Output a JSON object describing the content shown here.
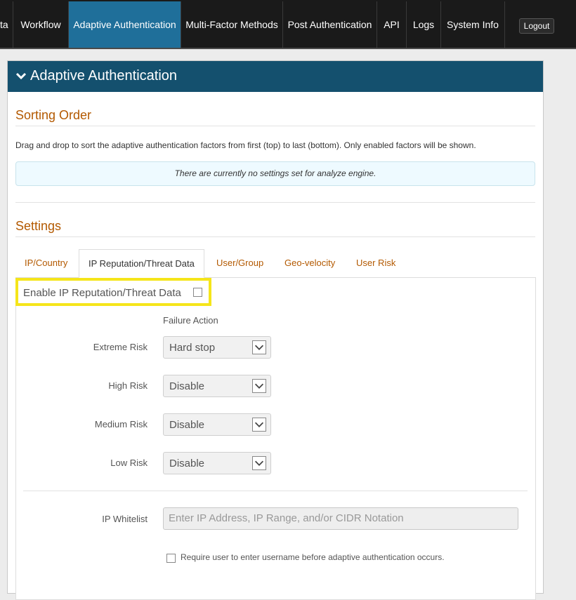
{
  "nav": {
    "items": [
      "ta",
      "Workflow",
      "Adaptive Authentication",
      "Multi-Factor Methods",
      "Post Authentication",
      "API",
      "Logs",
      "System Info"
    ],
    "active_index": 2,
    "logout_label": "Logout"
  },
  "panel": {
    "title": "Adaptive Authentication"
  },
  "sorting": {
    "title": "Sorting Order",
    "description": "Drag and drop to sort the adaptive authentication factors from first (top) to last (bottom). Only enabled factors will be shown.",
    "empty_message": "There are currently no settings set for analyze engine."
  },
  "settings": {
    "title": "Settings",
    "tabs": [
      "IP/Country",
      "IP Reputation/Threat Data",
      "User/Group",
      "Geo-velocity",
      "User Risk"
    ],
    "active_tab_index": 1,
    "enable_label": "Enable IP Reputation/Threat Data",
    "enable_checked": false,
    "failure_action_header": "Failure Action",
    "risks": [
      {
        "label": "Extreme Risk",
        "value": "Hard stop"
      },
      {
        "label": "High Risk",
        "value": "Disable"
      },
      {
        "label": "Medium Risk",
        "value": "Disable"
      },
      {
        "label": "Low Risk",
        "value": "Disable"
      }
    ],
    "ip_whitelist_label": "IP Whitelist",
    "ip_whitelist_placeholder": "Enter IP Address, IP Range, and/or CIDR Notation",
    "ip_whitelist_value": "",
    "require_username_label": "Require user to enter username before adaptive authentication occurs.",
    "require_username_checked": false
  },
  "colors": {
    "nav_bg": "#1a1a1a",
    "nav_active": "#1f6f9a",
    "panel_header": "#14506e",
    "section_title": "#b35900",
    "highlight": "#f5e51a"
  }
}
